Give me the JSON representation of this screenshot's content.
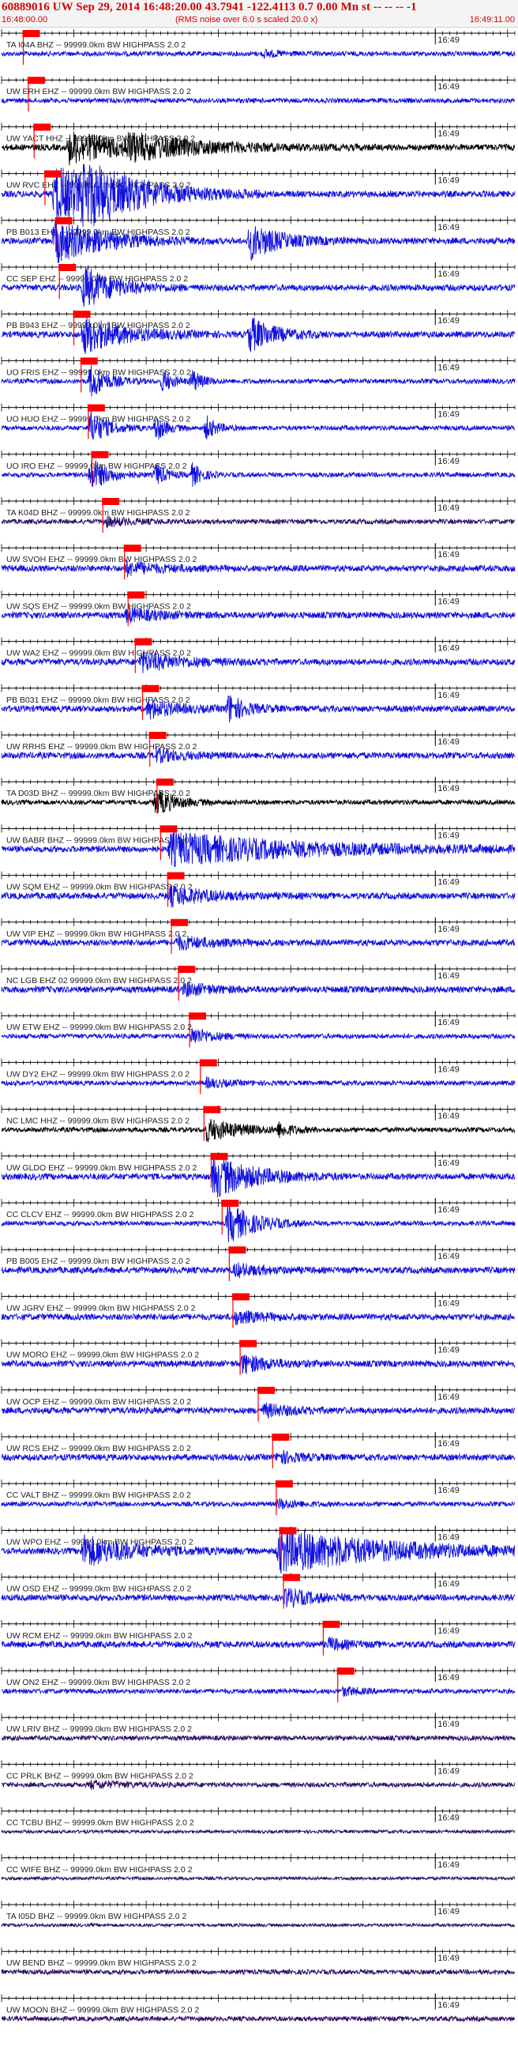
{
  "header": {
    "title": "60889016 UW Sep 29, 2014 16:48:20.00   43.7941 -122.4113  0.7 0.00 Mn st -- -- -- -1",
    "start_time": "16:48:00.00",
    "rms_note": "(RMS noise over 6.0 s scaled 20.0 x)",
    "end_time": "16:49:11.00"
  },
  "colors": {
    "trace_blue": "#1010e0",
    "trace_black": "#000000",
    "trace_purple": "#2a0a66",
    "pick_red": "#ff0000",
    "axis": "#000000",
    "label": "#222222"
  },
  "chart_data": {
    "type": "line",
    "title": "60889016 UW Sep 29, 2014 16:48:20.00   43.7941 -122.4113  0.7 0.00 Mn st -- -- -- -1",
    "x_range": [
      "16:48:00.00",
      "16:49:11.00"
    ],
    "x_range_seconds": [
      0,
      71
    ],
    "minute_tick_label": "16:49",
    "minute_tick_seconds": 60,
    "grid": false,
    "series": [
      {
        "name": "TA I04A BHZ -- 99999.0km BW  HIGHPASS  2.0  2",
        "pick_s": 3.0,
        "color": "blue",
        "amp": 3,
        "events": [
          [
            36,
            5,
            1.5
          ]
        ]
      },
      {
        "name": "UW ERH EHZ -- 99999.0km BW  HIGHPASS  2.0  2",
        "pick_s": 3.7,
        "color": "blue",
        "amp": 3,
        "events": []
      },
      {
        "name": "UW YACT HHZ -- 99999.0km BW  HIGHPASS  2.0  2",
        "pick_s": 4.5,
        "color": "black",
        "amp": 4,
        "events": [
          [
            9,
            18,
            5
          ],
          [
            17,
            22,
            3
          ]
        ]
      },
      {
        "name": "UW RVC EHZ -- 99999.0km BW  HIGHPASS  2.0  2",
        "pick_s": 6.0,
        "color": "blue",
        "amp": 4,
        "events": [
          [
            7,
            18,
            9
          ],
          [
            11,
            16,
            6
          ]
        ]
      },
      {
        "name": "PB B013 EHZ -- 99999.0km BW  HIGHPASS  2.0  2",
        "pick_s": 7.5,
        "color": "blue",
        "amp": 4,
        "events": [
          [
            7,
            14,
            7
          ],
          [
            34,
            9,
            6
          ]
        ]
      },
      {
        "name": "CC SEP EHZ -- 99999.0km BW  HIGHPASS  2.0  2",
        "pick_s": 8.0,
        "color": "blue",
        "amp": 4,
        "events": [
          [
            11,
            9,
            7
          ]
        ]
      },
      {
        "name": "PB B943 EHZ -- 99999.0km BW  HIGHPASS  2.0  2",
        "pick_s": 10.0,
        "color": "blue",
        "amp": 4,
        "events": [
          [
            11,
            12,
            6
          ],
          [
            34,
            7,
            6
          ]
        ]
      },
      {
        "name": "UO FRIS EHZ -- 99999.0km BW  HIGHPASS  2.0  2",
        "pick_s": 11.0,
        "color": "blue",
        "amp": 3,
        "events": [
          [
            12,
            5,
            8
          ],
          [
            22,
            3,
            6
          ],
          [
            26,
            3,
            6
          ]
        ]
      },
      {
        "name": "UO HUO EHZ -- 99999.0km BW  HIGHPASS  2.0  2",
        "pick_s": 12.0,
        "color": "blue",
        "amp": 3,
        "events": [
          [
            12,
            5,
            8
          ],
          [
            21,
            3,
            7
          ],
          [
            28,
            3,
            6
          ]
        ]
      },
      {
        "name": "UO IRO EHZ -- 99999.0km BW  HIGHPASS  2.0  2",
        "pick_s": 12.5,
        "color": "blue",
        "amp": 3,
        "events": [
          [
            12,
            5,
            8
          ],
          [
            21,
            3,
            6
          ],
          [
            26,
            3,
            6
          ]
        ]
      },
      {
        "name": "TA K04D BHZ -- 99999.0km BW  HIGHPASS  2.0  2",
        "pick_s": 14.0,
        "color": "purple",
        "amp": 3,
        "events": [
          [
            14,
            8,
            2
          ]
        ]
      },
      {
        "name": "UW SVOH EHZ -- 99999.0km BW  HIGHPASS  2.0  2",
        "pick_s": 17.0,
        "color": "blue",
        "amp": 4,
        "events": [
          [
            17,
            10,
            2
          ]
        ]
      },
      {
        "name": "UW SQS EHZ -- 99999.0km BW  HIGHPASS  2.0  2",
        "pick_s": 17.5,
        "color": "blue",
        "amp": 4,
        "events": [
          [
            17,
            10,
            2
          ]
        ]
      },
      {
        "name": "UW WA2 EHZ -- 99999.0km BW  HIGHPASS  2.0  2",
        "pick_s": 18.5,
        "color": "blue",
        "amp": 4,
        "events": [
          [
            19,
            12,
            3
          ]
        ]
      },
      {
        "name": "PB B031 EHZ -- 99999.0km BW  HIGHPASS  2.0  2",
        "pick_s": 19.5,
        "color": "blue",
        "amp": 4,
        "events": [
          [
            20,
            8,
            3
          ],
          [
            31,
            5,
            5
          ]
        ]
      },
      {
        "name": "UW RRHS EHZ -- 99999.0km BW  HIGHPASS  2.0  2",
        "pick_s": 20.5,
        "color": "blue",
        "amp": 4,
        "events": [
          [
            21,
            8,
            2
          ]
        ]
      },
      {
        "name": "TA D03D BHZ -- 99999.0km BW  HIGHPASS  2.0  2",
        "pick_s": 21.5,
        "color": "black",
        "amp": 3,
        "events": [
          [
            21,
            6,
            6
          ]
        ]
      },
      {
        "name": "UW BABR BHZ -- 99999.0km BW  HIGHPASS  2.0  2",
        "pick_s": 22.0,
        "color": "blue",
        "amp": 4,
        "events": [
          [
            23,
            40,
            5
          ]
        ]
      },
      {
        "name": "UW SQM EHZ -- 99999.0km BW  HIGHPASS  2.0  2",
        "pick_s": 23.0,
        "color": "blue",
        "amp": 4,
        "events": [
          [
            23,
            12,
            3
          ]
        ]
      },
      {
        "name": "UW VIP EHZ -- 99999.0km BW  HIGHPASS  2.0  2",
        "pick_s": 23.5,
        "color": "blue",
        "amp": 4,
        "events": [
          [
            24,
            10,
            2
          ]
        ]
      },
      {
        "name": "NC LGB EHZ 02 99999.0km BW  HIGHPASS  2.0  2",
        "pick_s": 24.5,
        "color": "blue",
        "amp": 4,
        "events": [
          [
            25,
            8,
            2
          ]
        ]
      },
      {
        "name": "UW ETW EHZ -- 99999.0km BW  HIGHPASS  2.0  2",
        "pick_s": 26.0,
        "color": "blue",
        "amp": 3,
        "events": [
          [
            26,
            6,
            4
          ]
        ]
      },
      {
        "name": "UW DY2 EHZ -- 99999.0km BW  HIGHPASS  2.0  2",
        "pick_s": 27.5,
        "color": "blue",
        "amp": 3,
        "events": [
          [
            28,
            6,
            2
          ]
        ]
      },
      {
        "name": "NC LMC HHZ -- 99999.0km BW  HIGHPASS  2.0  2",
        "pick_s": 28.0,
        "color": "black",
        "amp": 3,
        "events": [
          [
            28,
            10,
            5
          ],
          [
            38,
            4,
            3
          ]
        ]
      },
      {
        "name": "UW GLDO EHZ -- 99999.0km BW  HIGHPASS  2.0  2",
        "pick_s": 29.0,
        "color": "blue",
        "amp": 4,
        "events": [
          [
            29,
            12,
            7
          ]
        ]
      },
      {
        "name": "CC CLCV EHZ -- 99999.0km BW  HIGHPASS  2.0  2",
        "pick_s": 30.5,
        "color": "blue",
        "amp": 3,
        "events": [
          [
            31,
            8,
            9
          ]
        ]
      },
      {
        "name": "PB B005 EHZ -- 99999.0km BW  HIGHPASS  2.0  2",
        "pick_s": 31.5,
        "color": "blue",
        "amp": 4,
        "events": [
          [
            32,
            8,
            2
          ]
        ]
      },
      {
        "name": "UW JGRV EHZ -- 99999.0km BW  HIGHPASS  2.0  2",
        "pick_s": 32.0,
        "color": "blue",
        "amp": 4,
        "events": [
          [
            32,
            8,
            2
          ]
        ]
      },
      {
        "name": "UW MORO EHZ -- 99999.0km BW  HIGHPASS  2.0  2",
        "pick_s": 33.0,
        "color": "blue",
        "amp": 4,
        "events": [
          [
            33,
            8,
            3
          ]
        ]
      },
      {
        "name": "UW OCP EHZ -- 99999.0km BW  HIGHPASS  2.0  2",
        "pick_s": 35.5,
        "color": "blue",
        "amp": 4,
        "events": [
          [
            36,
            8,
            2
          ]
        ]
      },
      {
        "name": "UW RCS EHZ -- 99999.0km BW  HIGHPASS  2.0  2",
        "pick_s": 37.5,
        "color": "blue",
        "amp": 4,
        "events": [
          [
            38,
            6,
            2
          ]
        ]
      },
      {
        "name": "CC VALT BHZ -- 99999.0km BW  HIGHPASS  2.0  2",
        "pick_s": 38.0,
        "color": "blue",
        "amp": 3,
        "events": [
          [
            38,
            6,
            2
          ]
        ]
      },
      {
        "name": "UW WPO EHZ -- 99999.0km BW  HIGHPASS  2.0  2",
        "pick_s": 38.5,
        "color": "blue",
        "amp": 4,
        "events": [
          [
            11,
            14,
            5
          ],
          [
            38,
            33,
            7
          ]
        ]
      },
      {
        "name": "UW OSD EHZ -- 99999.0km BW  HIGHPASS  2.0  2",
        "pick_s": 39.0,
        "color": "blue",
        "amp": 4,
        "events": [
          [
            39,
            8,
            3
          ]
        ]
      },
      {
        "name": "UW RCM EHZ -- 99999.0km BW  HIGHPASS  2.0  2",
        "pick_s": 44.5,
        "color": "blue",
        "amp": 4,
        "events": [
          [
            45,
            5,
            2
          ]
        ]
      },
      {
        "name": "UW ON2 EHZ -- 99999.0km BW  HIGHPASS  2.0  2",
        "pick_s": 46.5,
        "color": "blue",
        "amp": 3,
        "events": [
          [
            47,
            5,
            2
          ]
        ]
      },
      {
        "name": "UW LRIV BHZ -- 99999.0km BW  HIGHPASS  2.0  2",
        "pick_s": null,
        "color": "purple",
        "amp": 3,
        "events": []
      },
      {
        "name": "CC PRLK BHZ -- 99999.0km BW  HIGHPASS  2.0  2",
        "pick_s": null,
        "color": "purple",
        "amp": 3,
        "events": [
          [
            12,
            10,
            1.5
          ]
        ]
      },
      {
        "name": "CC TCBU BHZ -- 99999.0km BW  HIGHPASS  2.0  2",
        "pick_s": null,
        "color": "purple",
        "amp": 2,
        "events": []
      },
      {
        "name": "CC WIFE BHZ -- 99999.0km BW  HIGHPASS  2.0  2",
        "pick_s": null,
        "color": "purple",
        "amp": 2,
        "events": []
      },
      {
        "name": "TA I05D BHZ -- 99999.0km BW  HIGHPASS  2.0  2",
        "pick_s": null,
        "color": "purple",
        "amp": 2,
        "events": []
      },
      {
        "name": "UW BEND BHZ -- 99999.0km BW  HIGHPASS  2.0  2",
        "pick_s": null,
        "color": "purple",
        "amp": 3,
        "events": []
      },
      {
        "name": "UW MOON BHZ -- 99999.0km BW  HIGHPASS  2.0  2",
        "pick_s": null,
        "color": "purple",
        "amp": 3,
        "events": []
      }
    ]
  }
}
